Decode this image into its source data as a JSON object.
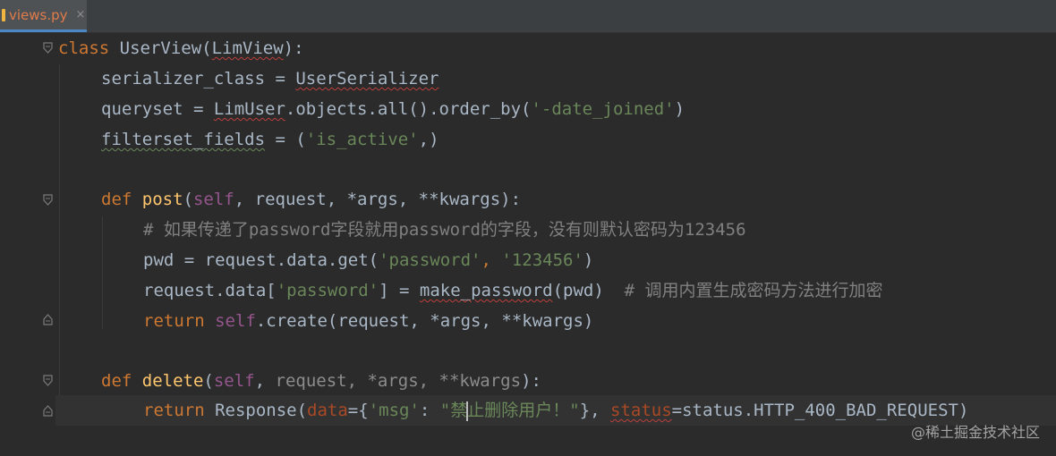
{
  "tab": {
    "filename": "views.py",
    "close": "×"
  },
  "code": {
    "l1": {
      "kw": "class ",
      "name": "UserView(",
      "base": "LimView",
      "end": "):"
    },
    "l2": {
      "lhs": "serializer_class = ",
      "rhs": "UserSerializer"
    },
    "l3": {
      "a": "queryset = ",
      "b": "LimUser",
      "c": ".objects.all().order_by(",
      "s": "'-date_joined'",
      "d": ")"
    },
    "l4": {
      "a": "filterset_fields",
      "b": " = (",
      "s": "'is_active'",
      "c": ",)"
    },
    "l6": {
      "kw": "def ",
      "fn": "post",
      "p1": "(",
      "self": "self",
      "p2": ", request, *args, **kwargs):"
    },
    "l7": {
      "comment": "# 如果传递了password字段就用password的字段，没有则默认密码为123456"
    },
    "l8": {
      "a": "pwd = request.data.get(",
      "s1": "'password'",
      "c": ", ",
      "s2": "'123456'",
      "d": ")"
    },
    "l9": {
      "a": "request.data[",
      "s": "'password'",
      "b": "] = ",
      "fn": "make_password",
      "c": "(pwd)  ",
      "comment": "# 调用内置生成密码方法进行加密"
    },
    "l10": {
      "kw": "return ",
      "self": "self",
      "rest": ".create(request, *args, **kwargs)"
    },
    "l12": {
      "kw": "def ",
      "fn": "delete",
      "p1": "(",
      "self": "self",
      "p2": ", ",
      "dim": "request, *args, **kwargs",
      "p3": "):"
    },
    "l13": {
      "kw": "return ",
      "a": "Response(",
      "par": "data",
      "b": "={",
      "s": "'msg'",
      "c": ": ",
      "s2a": "\"禁",
      "s2b": "止删除用户！\"",
      "d": "}, ",
      "par2": "status",
      "e": "=status.HTTP_400_BAD_REQUEST)"
    }
  },
  "watermark": "@稀土掘金技术社区",
  "colors": {
    "background": "#2b2b2b",
    "keyword": "#cc7832",
    "function": "#ffc66d",
    "self": "#94558d",
    "string": "#6a8759",
    "comment": "#808080",
    "text": "#a9b7c6"
  }
}
